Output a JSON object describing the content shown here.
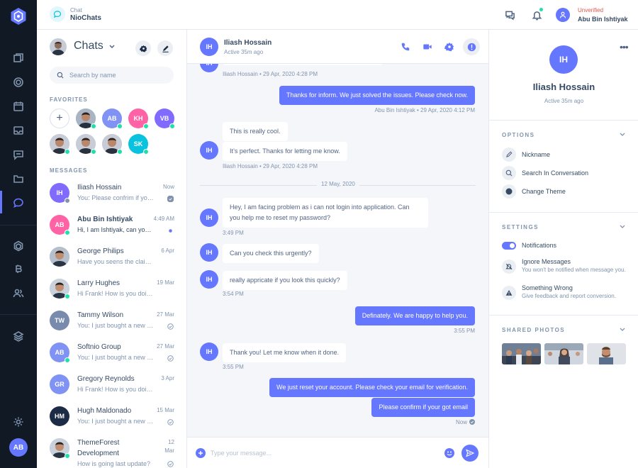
{
  "app": {
    "section": "Chat",
    "name": "NioChats"
  },
  "user": {
    "role": "Unverified",
    "name": "Abu Bin Ishtiyak",
    "initials": "AB"
  },
  "chat_list": {
    "title": "Chats",
    "search_placeholder": "Search by name",
    "favorites_label": "FAVORITES",
    "messages_label": "MESSAGES",
    "favorites": [
      {
        "initials": "",
        "color": "#ffffff"
      },
      {
        "initials": "",
        "color": "#a9b4c5"
      },
      {
        "initials": "AB",
        "color": "#8093f5"
      },
      {
        "initials": "KH",
        "color": "#ff63a5"
      },
      {
        "initials": "VB",
        "color": "#816bff"
      },
      {
        "initials": "",
        "color": "#c7ccd6"
      },
      {
        "initials": "",
        "color": "#c7ccd6"
      },
      {
        "initials": "",
        "color": "#c7ccd6"
      },
      {
        "initials": "SK",
        "color": "#09c2de"
      }
    ],
    "messages": [
      {
        "name": "Iliash Hossain",
        "preview": "You: Please confrim if you got my last messages.",
        "time": "Now",
        "initials": "IH",
        "color": "#816bff",
        "presence": "offline",
        "status": "read"
      },
      {
        "name": "Abu Bin Ishtiyak",
        "preview": "Hi, I am Ishtiyak, can you help me with this problem?",
        "time": "4:49 AM",
        "initials": "AB",
        "color": "#ff63a5",
        "presence": "online",
        "status": "unread"
      },
      {
        "name": "George Philips",
        "preview": "Have you seens the claim from Rose?",
        "time": "6 Apr",
        "initials": "",
        "color": "#b6bfcc",
        "presence": "none",
        "status": ""
      },
      {
        "name": "Larry Hughes",
        "preview": "Hi Frank! How is you doing?",
        "time": "19 Mar",
        "initials": "",
        "color": "#c9d1dc",
        "presence": "online",
        "status": ""
      },
      {
        "name": "Tammy Wilson",
        "preview": "You: I just bought a new computer but i am having some problem",
        "time": "27 Mar",
        "initials": "TW",
        "color": "#798bac",
        "presence": "none",
        "status": "read"
      },
      {
        "name": "Softnio Group",
        "preview": "You: I just bought a new computer but i am having some problem",
        "time": "27 Mar",
        "initials": "AB",
        "color": "#8093f5",
        "presence": "online",
        "status": "read"
      },
      {
        "name": "Gregory Reynolds",
        "preview": "Hi Frank! How is you doing?",
        "time": "3 Apr",
        "initials": "GR",
        "color": "#8093f5",
        "presence": "none",
        "status": ""
      },
      {
        "name": "Hugh Maldonado",
        "preview": "You: I just bought a new computer but i am having some problem",
        "time": "15 Mar",
        "initials": "HM",
        "color": "#1c2b46",
        "presence": "none",
        "status": "read"
      },
      {
        "name": "ThemeForest",
        "name2": "Development",
        "preview": "How is going last update?",
        "time": "12",
        "time2": "Mar",
        "initials": "",
        "color": "#c9d1dc",
        "presence": "online",
        "status": "read"
      }
    ]
  },
  "conversation": {
    "name": "Iliash Hossain",
    "initials": "IH",
    "status": "Active 35m ago",
    "date_divider": "12 May, 2020",
    "messages": [
      {
        "text": "",
        "meta": "Iliash Hossain • 29 Apr, 2020 4:28 PM"
      },
      {
        "text": "Thanks for inform. We just solved the issues. Please check now.",
        "meta": "Abu Bin Ishtiyak • 29 Apr, 2020 4:12 PM"
      },
      {
        "text": "This is really cool.",
        "meta": ""
      },
      {
        "text": "It’s perfect. Thanks for letting me know.",
        "meta": "Iliash Hossain • 29 Apr, 2020 4:28 PM"
      },
      {
        "text": "Hey, I am facing problem as i can not login into application. Can you help me to reset my password?",
        "meta": "3:49 PM"
      },
      {
        "text": "Can you check this urgently?",
        "meta": ""
      },
      {
        "text": "really appricate if you look this quickly?",
        "meta": "3:54 PM"
      },
      {
        "text": "Definately. We are happy to help you.",
        "meta": "3:55 PM"
      },
      {
        "text": "Thank you! Let me know when it done.",
        "meta": "3:55 PM"
      },
      {
        "text": "We just reset your account. Please check your email for verification.",
        "meta": ""
      },
      {
        "text": "Please confirm if your got email",
        "meta": "Now"
      }
    ],
    "composer_placeholder": "Type your message..."
  },
  "profile": {
    "initials": "IH",
    "name": "Iliash Hossain",
    "status": "Active 35m ago",
    "options_label": "OPTIONS",
    "options": [
      {
        "label": "Nickname",
        "icon": "pencil-icon"
      },
      {
        "label": "Search In Conversation",
        "icon": "search-icon"
      },
      {
        "label": "Change Theme",
        "icon": "theme-circle-icon"
      }
    ],
    "settings_label": "SETTINGS",
    "settings": [
      {
        "title": "Notifications",
        "desc": "",
        "icon": "toggle-on"
      },
      {
        "title": "Ignore Messages",
        "desc": "You won't be notified when message you.",
        "icon": "bell-off-icon"
      },
      {
        "title": "Something Wrong",
        "desc": "Give feedback and report conversion.",
        "icon": "alert-icon"
      }
    ],
    "photos_label": "SHARED PHOTOS"
  },
  "colors": {
    "accent": "#6576ff",
    "online": "#1ee0ac",
    "rail": "#101924"
  }
}
